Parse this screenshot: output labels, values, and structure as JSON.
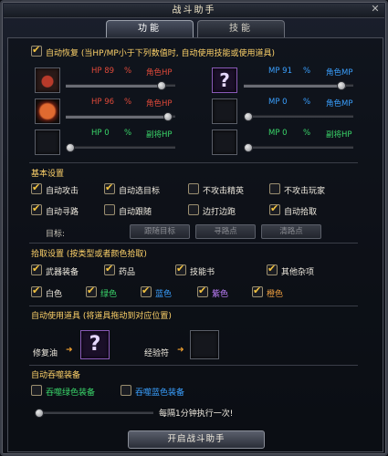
{
  "window": {
    "title": "战斗助手"
  },
  "tabs": [
    {
      "label": "功能"
    },
    {
      "label": "技能"
    }
  ],
  "recovery": {
    "title": "自动恢复 (当HP/MP小于下列数值时, 自动使用技能或使用道具)",
    "rows": [
      {
        "left": {
          "stat": "HP 89",
          "pct": "%",
          "target": "角色HP",
          "level": 0.91
        },
        "right": {
          "stat": "MP 91",
          "pct": "%",
          "target": "角色MP",
          "level": 0.93
        }
      },
      {
        "left": {
          "stat": "HP 96",
          "pct": "%",
          "target": "角色HP",
          "level": 0.97
        },
        "right": {
          "stat": "MP 0",
          "pct": "%",
          "target": "角色MP",
          "level": 0.0
        }
      },
      {
        "left": {
          "stat": "HP 0",
          "pct": "%",
          "target": "副将HP",
          "level": 0.0
        },
        "right": {
          "stat": "MP 0",
          "pct": "%",
          "target": "副将HP",
          "level": 0.0
        }
      }
    ]
  },
  "basic": {
    "title": "基本设置",
    "options": [
      {
        "label": "自动攻击",
        "checked": true
      },
      {
        "label": "自动选目标",
        "checked": true
      },
      {
        "label": "不攻击精英",
        "checked": false
      },
      {
        "label": "不攻击玩家",
        "checked": false
      },
      {
        "label": "自动寻路",
        "checked": true
      },
      {
        "label": "自动跟随",
        "checked": false
      },
      {
        "label": "边打边跑",
        "checked": false
      },
      {
        "label": "自动拾取",
        "checked": true
      }
    ],
    "target_label": "目标:",
    "buttons": [
      "跟随目标",
      "寻路点",
      "清路点"
    ]
  },
  "pickup": {
    "title": "拾取设置 (按类型或者颜色拾取)",
    "types": [
      {
        "label": "武器装备",
        "checked": true
      },
      {
        "label": "药品",
        "checked": true
      },
      {
        "label": "技能书",
        "checked": true
      },
      {
        "label": "其他杂项",
        "checked": true
      }
    ],
    "colors": [
      {
        "label": "白色",
        "checked": true,
        "color": "#f0ebe0"
      },
      {
        "label": "绿色",
        "checked": true,
        "color": "#3ad66a"
      },
      {
        "label": "蓝色",
        "checked": true,
        "color": "#3aa0ff"
      },
      {
        "label": "紫色",
        "checked": true,
        "color": "#c080ff"
      },
      {
        "label": "橙色",
        "checked": true,
        "color": "#f0a040"
      }
    ]
  },
  "items": {
    "title": "自动使用道具 (将道具拖动到对应位置)",
    "repair_label": "修复油",
    "exp_label": "经验符"
  },
  "devour": {
    "title": "自动吞噬装备",
    "options": [
      {
        "label": "吞噬绿色装备",
        "checked": false
      },
      {
        "label": "吞噬蓝色装备",
        "checked": false
      }
    ],
    "interval_text": "每隔1分钟执行一次!",
    "interval_level": 0.0
  },
  "start_button": "开启战斗助手",
  "icons": {
    "close": "close-icon",
    "hp_potion": "red-jar-icon",
    "hp_skill": "flame-figure-icon",
    "unknown_item": "question-mark-icon",
    "arrow": "arrow-right-icon"
  }
}
